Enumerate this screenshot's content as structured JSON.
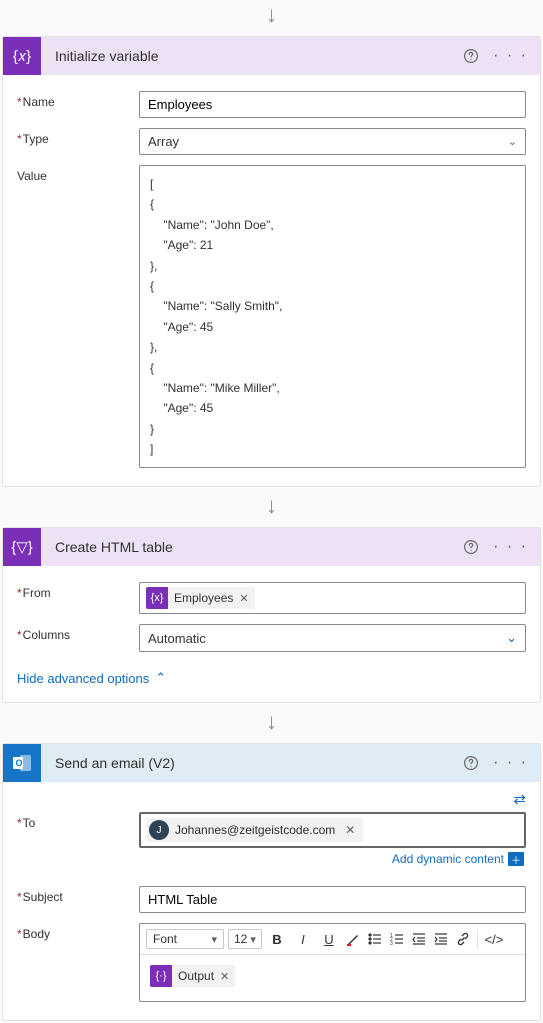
{
  "arrow_in": "↓",
  "init": {
    "title": "Initialize variable",
    "name_label": "Name",
    "name_value": "Employees",
    "type_label": "Type",
    "type_value": "Array",
    "value_label": "Value",
    "value_content": "[\n{\n    \"Name\": \"John Doe\",\n    \"Age\": 21\n},\n{\n    \"Name\": \"Sally Smith\",\n    \"Age\": 45\n},\n{\n    \"Name\": \"Mike Miller\",\n    \"Age\": 45\n}\n]"
  },
  "html": {
    "title": "Create HTML table",
    "from_label": "From",
    "from_token": "Employees",
    "columns_label": "Columns",
    "columns_value": "Automatic",
    "hide_adv": "Hide advanced options"
  },
  "email": {
    "title": "Send an email (V2)",
    "to_label": "To",
    "to_avatar": "J",
    "to_value": "Johannes@zeitgeistcode.com",
    "dynamic_label": "Add dynamic content",
    "subject_label": "Subject",
    "subject_value": "HTML Table",
    "body_label": "Body",
    "toolbar": {
      "font": "Font",
      "size": "12"
    },
    "body_token": "Output"
  },
  "icons": {
    "chev_down": "⌄",
    "ellipsis": "· · ·"
  }
}
